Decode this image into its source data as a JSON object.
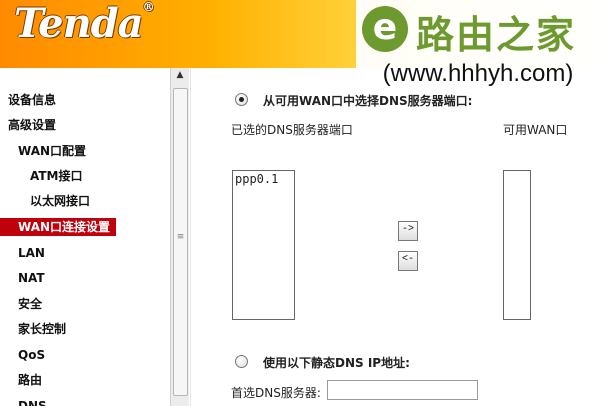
{
  "header": {
    "logo_text": "Tenda",
    "logo_mark": "®",
    "watermark": {
      "title": "路由之家",
      "url": "(www.hhhyh.com)",
      "icon_letter": "e"
    }
  },
  "sidebar": {
    "items": [
      {
        "label": "设备信息"
      },
      {
        "label": "高级设置"
      },
      {
        "label": "WAN口配置"
      },
      {
        "label": "ATM接口"
      },
      {
        "label": "以太网接口"
      },
      {
        "label": "WAN口连接设置"
      },
      {
        "label": "LAN"
      },
      {
        "label": "NAT"
      },
      {
        "label": "安全"
      },
      {
        "label": "家长控制"
      },
      {
        "label": "QoS"
      },
      {
        "label": "路由"
      },
      {
        "label": "DNS"
      }
    ],
    "active_index": 5,
    "active_color": "#c0000a"
  },
  "main": {
    "option1_label": "从可用WAN口中选择DNS服务器端口:",
    "option1_checked": true,
    "selected_ports_label": "已选的DNS服务器端口",
    "available_ports_label": "可用WAN口",
    "selected_ports": [
      "ppp0.1"
    ],
    "available_ports": [],
    "btn_add": "->",
    "btn_remove": "<-",
    "option2_label": "使用以下静态DNS IP地址:",
    "option2_checked": false,
    "primary_dns_label": "首选DNS服务器:",
    "primary_dns_value": ""
  },
  "colors": {
    "header_start": "#ff8a00",
    "header_end": "#fff6d0",
    "watermark_green": "#6d9a2e"
  }
}
